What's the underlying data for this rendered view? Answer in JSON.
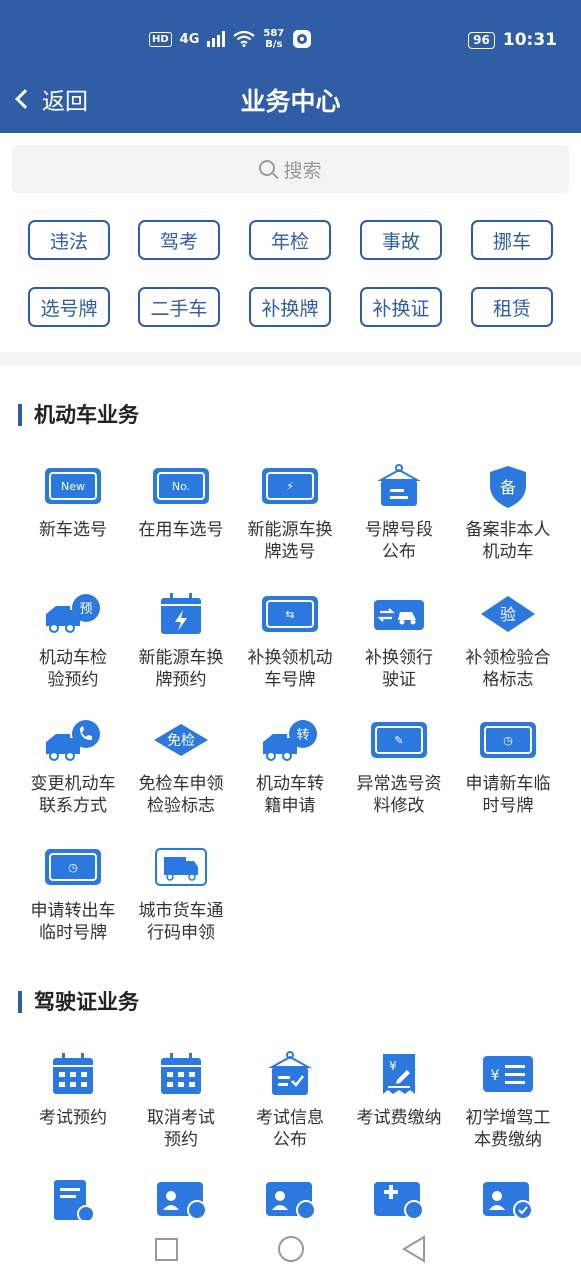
{
  "status_bar": {
    "network": "4G",
    "speed_top": "587",
    "speed_bottom": "B/s",
    "battery": "96",
    "time": "10:31"
  },
  "nav": {
    "back_label": "返回",
    "title": "业务中心"
  },
  "search": {
    "placeholder": "搜索"
  },
  "quick_tags": [
    "违法",
    "驾考",
    "年检",
    "事故",
    "挪车",
    "选号牌",
    "二手车",
    "补换牌",
    "补换证",
    "租赁"
  ],
  "vehicle_section": {
    "title": "机动车业务",
    "items": [
      {
        "label": "新车选号",
        "icon": "new-plate-icon"
      },
      {
        "label": "在用车选号",
        "icon": "no-plate-icon"
      },
      {
        "label": "新能源车换牌选号",
        "icon": "ev-plate-icon"
      },
      {
        "label": "号牌号段公布",
        "icon": "notice-board-icon"
      },
      {
        "label": "备案非本人机动车",
        "icon": "shield-record-icon"
      },
      {
        "label": "机动车检验预约",
        "icon": "truck-reserve-icon"
      },
      {
        "label": "新能源车换牌预约",
        "icon": "ev-calendar-icon"
      },
      {
        "label": "补换领机动车号牌",
        "icon": "swap-plate-icon"
      },
      {
        "label": "补换领行驶证",
        "icon": "license-car-icon"
      },
      {
        "label": "补领检验合格标志",
        "icon": "inspect-diamond-icon"
      },
      {
        "label": "变更机动车联系方式",
        "icon": "truck-phone-icon"
      },
      {
        "label": "免检车申领检验标志",
        "icon": "exempt-diamond-icon"
      },
      {
        "label": "机动车转籍申请",
        "icon": "truck-transfer-icon"
      },
      {
        "label": "异常选号资料修改",
        "icon": "edit-plate-icon"
      },
      {
        "label": "申请新车临时号牌",
        "icon": "temp-plate-icon"
      },
      {
        "label": "申请转出车临时号牌",
        "icon": "temp-plate-out-icon"
      },
      {
        "label": "城市货车通行码申领",
        "icon": "freight-truck-icon"
      }
    ],
    "badges": {
      "new": "New",
      "no": "No.",
      "reserve": "预",
      "inspect": "验",
      "exempt": "免检",
      "transfer": "转",
      "record": "备"
    }
  },
  "license_section": {
    "title": "驾驶证业务",
    "items": [
      {
        "label": "考试预约",
        "icon": "calendar-icon"
      },
      {
        "label": "取消考试预约",
        "icon": "calendar-cancel-icon"
      },
      {
        "label": "考试信息公布",
        "icon": "notice-check-icon"
      },
      {
        "label": "考试费缴纳",
        "icon": "fee-receipt-icon"
      },
      {
        "label": "初学增驾工本费缴纳",
        "icon": "fee-list-icon"
      }
    ]
  },
  "colors": {
    "header": "#2f5ea6",
    "accent": "#2b79de"
  }
}
